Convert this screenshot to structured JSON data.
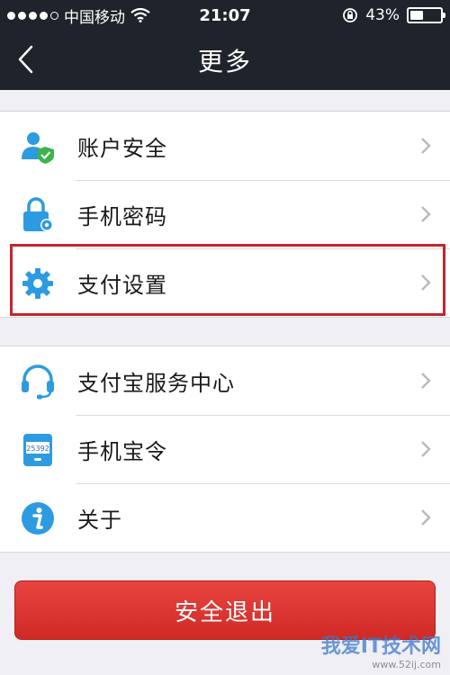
{
  "status_bar": {
    "carrier": "中国移动",
    "time": "21:07",
    "battery": "43%",
    "battery_level": 0.43
  },
  "nav": {
    "title": "更多"
  },
  "group1": [
    {
      "label": "账户安全",
      "icon": "user-shield-icon"
    },
    {
      "label": "手机密码",
      "icon": "lock-gear-icon"
    },
    {
      "label": "支付设置",
      "icon": "gear-icon"
    }
  ],
  "group2": [
    {
      "label": "支付宝服务中心",
      "icon": "headset-icon"
    },
    {
      "label": "手机宝令",
      "icon": "token-device-icon",
      "icon_text": "25392"
    },
    {
      "label": "关于",
      "icon": "info-icon"
    }
  ],
  "logout_label": "安全退出",
  "watermark": {
    "text": "我爱IT技术网",
    "url": "www.52ij.com"
  },
  "colors": {
    "nav_bg": "#1f232b",
    "page_bg": "#efeff4",
    "accent_blue": "#2d9be0",
    "logout_red": "#dd3733",
    "highlight_red": "#c8232c"
  }
}
